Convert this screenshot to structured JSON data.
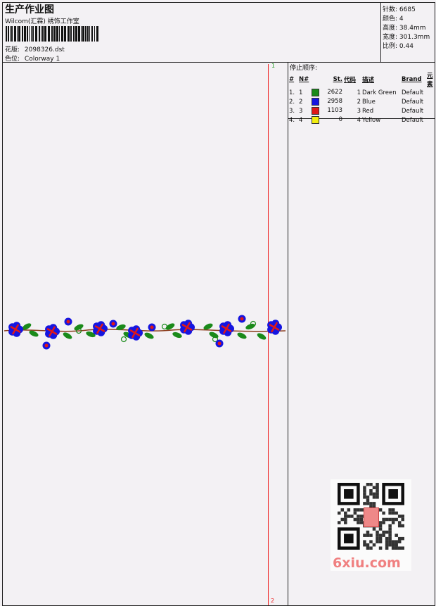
{
  "header": {
    "title": "生产作业图",
    "company": "Wilcom(汇霖) 绣饰工作室",
    "design_label": "花版:",
    "design_value": "2098326.dst",
    "colorway_label": "色位:",
    "colorway_value": "Colorway 1"
  },
  "stats": [
    {
      "label": "针数:",
      "value": "6685"
    },
    {
      "label": "颜色:",
      "value": "4"
    },
    {
      "label": "高度:",
      "value": "38.4mm"
    },
    {
      "label": "宽度:",
      "value": "301.3mm"
    },
    {
      "label": "比例:",
      "value": "0.44"
    }
  ],
  "stop_sequence": {
    "title": "停止顺序:",
    "columns": [
      "#",
      "N#",
      "St.",
      "代码",
      "描述",
      "Brand",
      "元素"
    ],
    "rows": [
      {
        "num": "1.",
        "n": "1",
        "color": "#1a8a1a",
        "stitches": "2622",
        "code": "1",
        "description": "Dark Green",
        "brand": "Default"
      },
      {
        "num": "2.",
        "n": "2",
        "color": "#1515e0",
        "stitches": "2958",
        "code": "2",
        "description": "Blue",
        "brand": "Default"
      },
      {
        "num": "3.",
        "n": "3",
        "color": "#e01818",
        "stitches": "1103",
        "code": "3",
        "description": "Red",
        "brand": "Default"
      },
      {
        "num": "4.",
        "n": "4",
        "color": "#f2ee10",
        "stitches": "0",
        "code": "4",
        "description": "Yellow",
        "brand": "Default"
      }
    ]
  },
  "markers": {
    "top": "1",
    "bottom": "2"
  },
  "watermark": "6xiu.com"
}
